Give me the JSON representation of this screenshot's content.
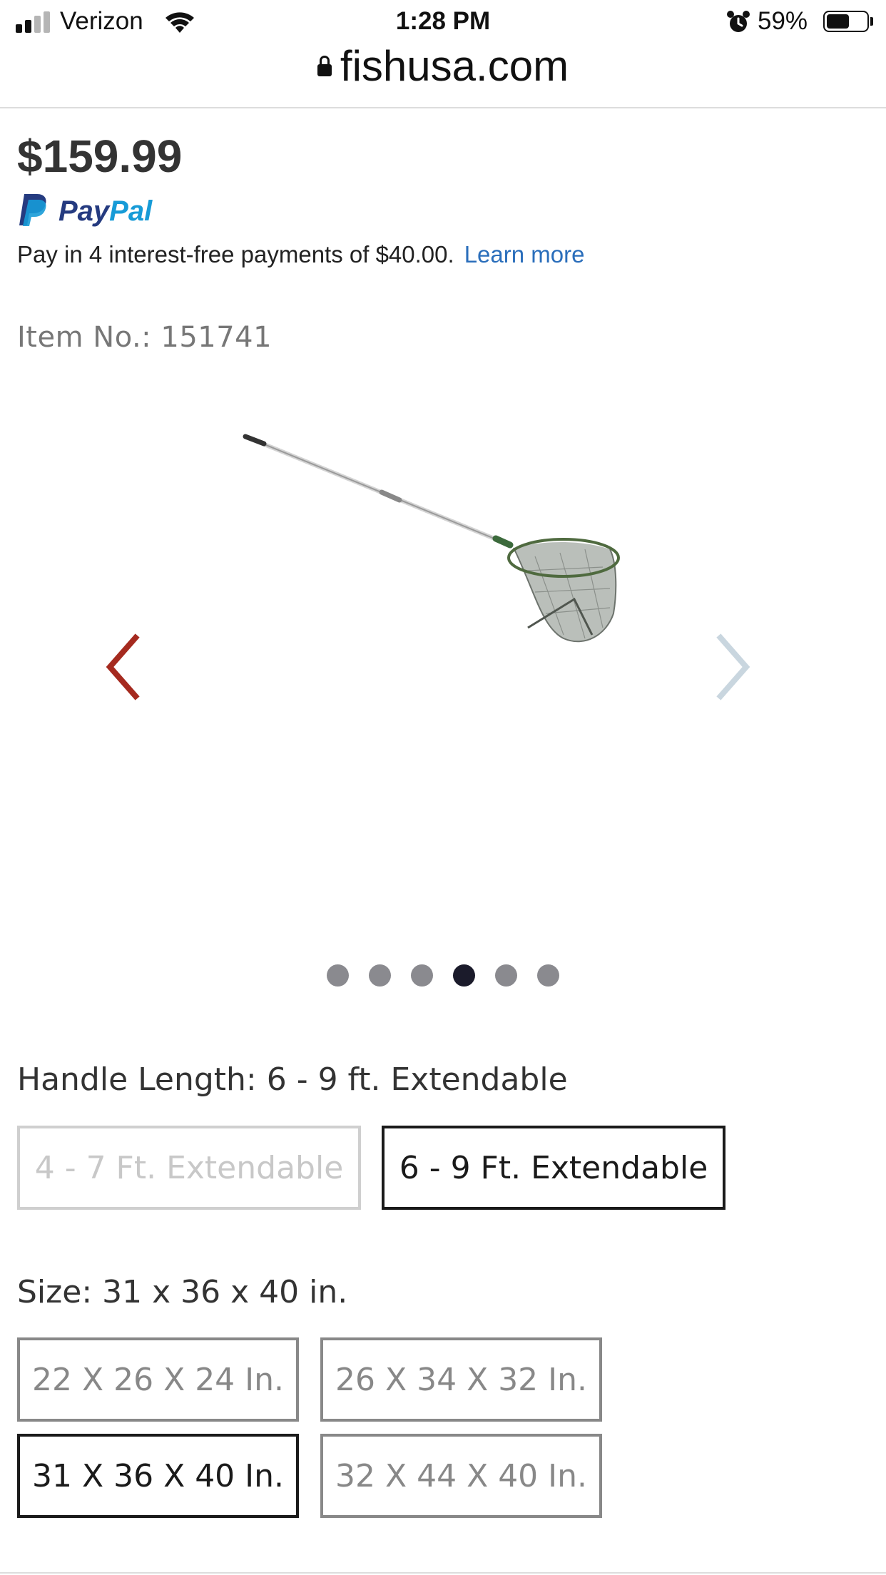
{
  "status_bar": {
    "carrier": "Verizon",
    "time": "1:28 PM",
    "battery_percent": "59%",
    "battery_level": 0.59,
    "icons": [
      "signal-icon",
      "wifi-icon",
      "alarm-icon",
      "battery-icon"
    ]
  },
  "browser": {
    "url": "fishusa.com",
    "lock_icon": "lock-icon"
  },
  "product": {
    "price": "$159.99",
    "paypal": {
      "brand": "PayPal",
      "message": "Pay in 4 interest-free payments of $40.00.",
      "learn_more": "Learn more",
      "colors": {
        "dark": "#253b80",
        "light": "#179bd7"
      }
    },
    "item_no": "Item No.: 151741",
    "gallery": {
      "image_alt": "landing net",
      "prev_icon": "chevron-left-icon",
      "next_icon": "chevron-right-icon",
      "prev_color": "#a52a1f",
      "next_color": "#c9d6df",
      "dot_count": 6,
      "active_dot": 4
    }
  },
  "options": {
    "handle_length": {
      "label": "Handle Length: 6 - 9 ft. Extendable",
      "choices": [
        {
          "label": "4 - 7 Ft. Extendable",
          "state": "unavailable"
        },
        {
          "label": "6 - 9 Ft. Extendable",
          "state": "selected"
        }
      ]
    },
    "size": {
      "label": "Size: 31 x 36 x 40 in.",
      "choices": [
        {
          "label": "22 X 26 X 24 In.",
          "state": "available"
        },
        {
          "label": "26 X 34 X 32 In.",
          "state": "available"
        },
        {
          "label": "31 X 36 X 40 In.",
          "state": "selected"
        },
        {
          "label": "32 X 44 X 40 In.",
          "state": "available"
        }
      ]
    }
  }
}
